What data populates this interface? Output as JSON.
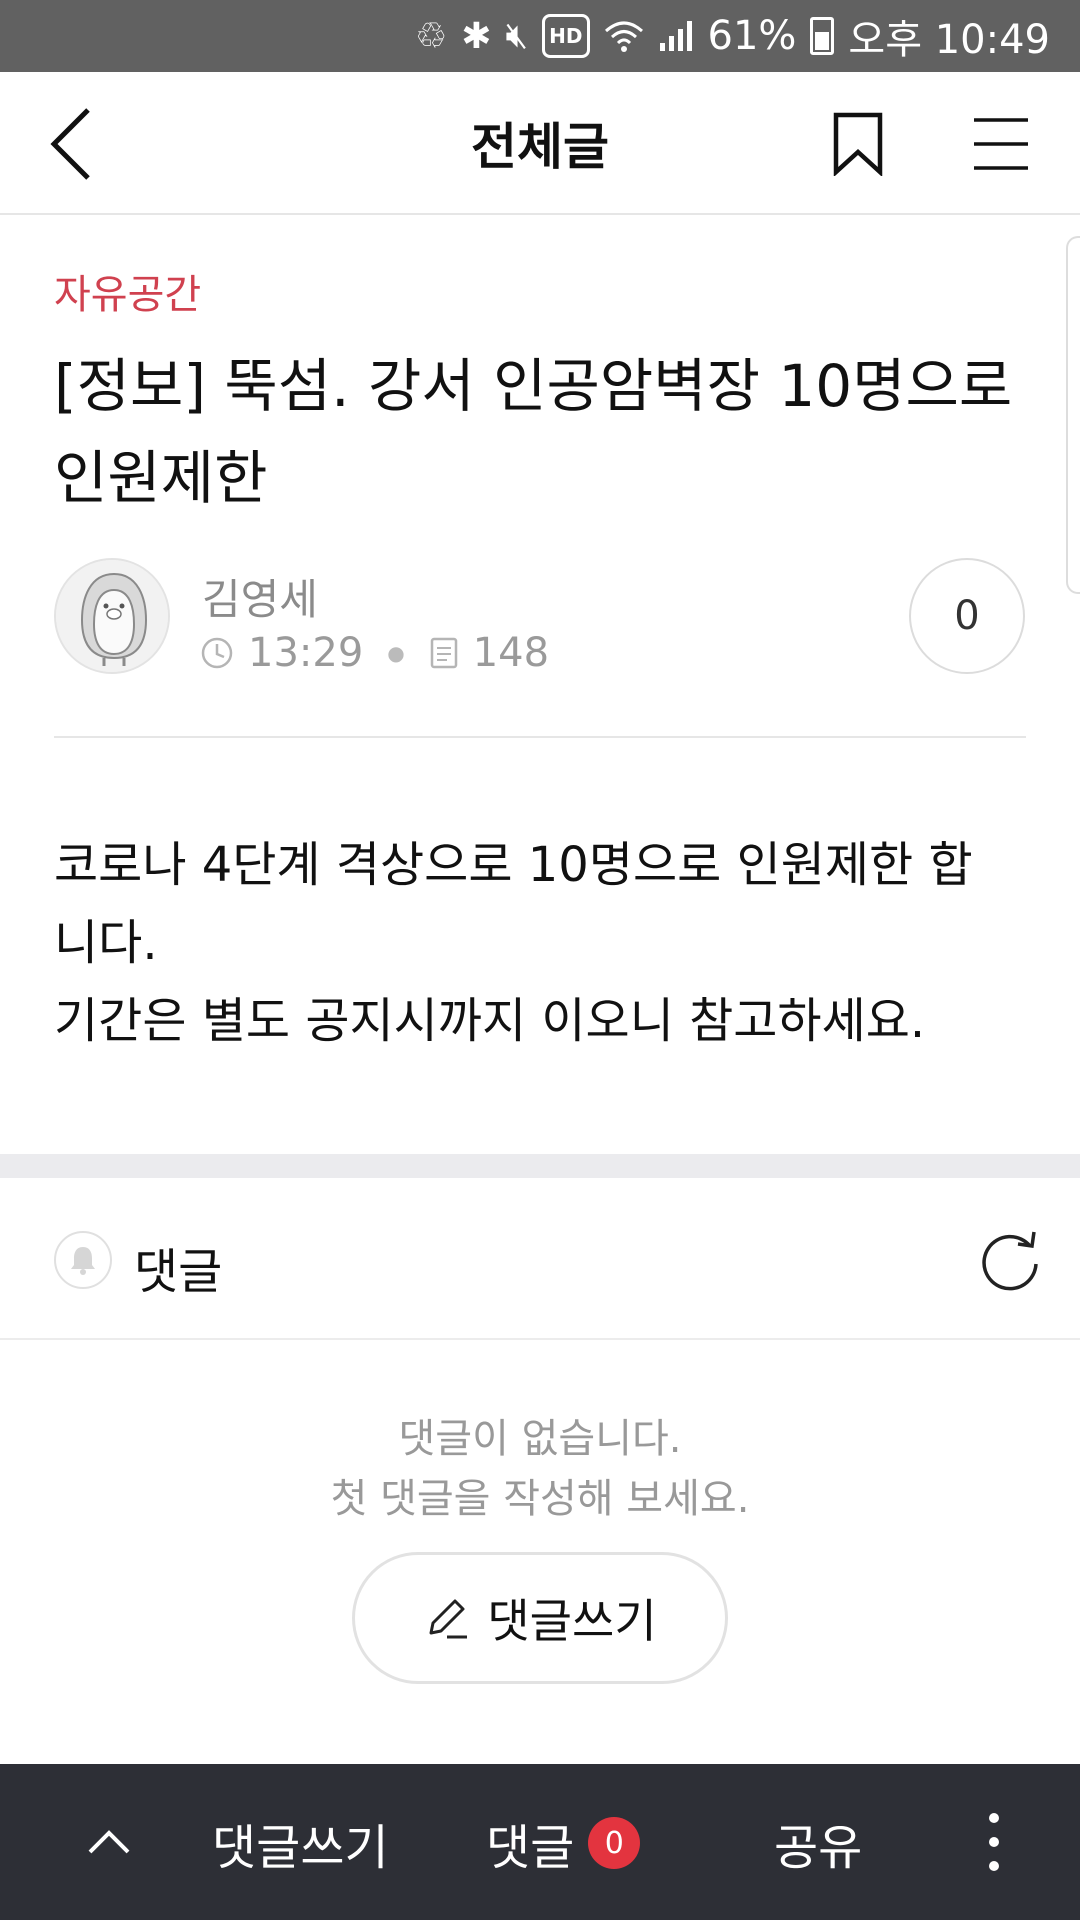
{
  "status_bar": {
    "battery": "61%",
    "time": "오후 10:49",
    "icons": [
      "data-saver-icon",
      "bluetooth-icon",
      "mute-icon",
      "hd-icon",
      "wifi-icon",
      "signal-icon",
      "battery-icon"
    ],
    "hd_label": "HD"
  },
  "header": {
    "title": "전체글",
    "icons": [
      "back-icon",
      "bookmark-icon",
      "menu-icon"
    ]
  },
  "post": {
    "category": "자유공간",
    "title_line1": "[정보] 뚝섬. 강서 인공암벽장 10명으로",
    "title_line2": "인원제한",
    "author": "김영세",
    "time": "13:29",
    "views": "148",
    "likes": "0",
    "body_line1": "코로나 4단계 격상으로 10명으로 인원제한 합",
    "body_line2": "니다.",
    "body_line3": "기간은 별도 공지시까지 이오니 참고하세요."
  },
  "comments": {
    "label": "댓글",
    "empty_line1": "댓글이 없습니다.",
    "empty_line2": "첫 댓글을 작성해 보세요.",
    "write_button": "댓글쓰기"
  },
  "bottom_bar": {
    "write": "댓글쓰기",
    "comments": "댓글",
    "comment_count": "0",
    "share": "공유"
  },
  "colors": {
    "category": "#d0414f",
    "badge": "#e3343f",
    "bottom_bar": "#2d2f36",
    "status_bar": "#616161"
  }
}
